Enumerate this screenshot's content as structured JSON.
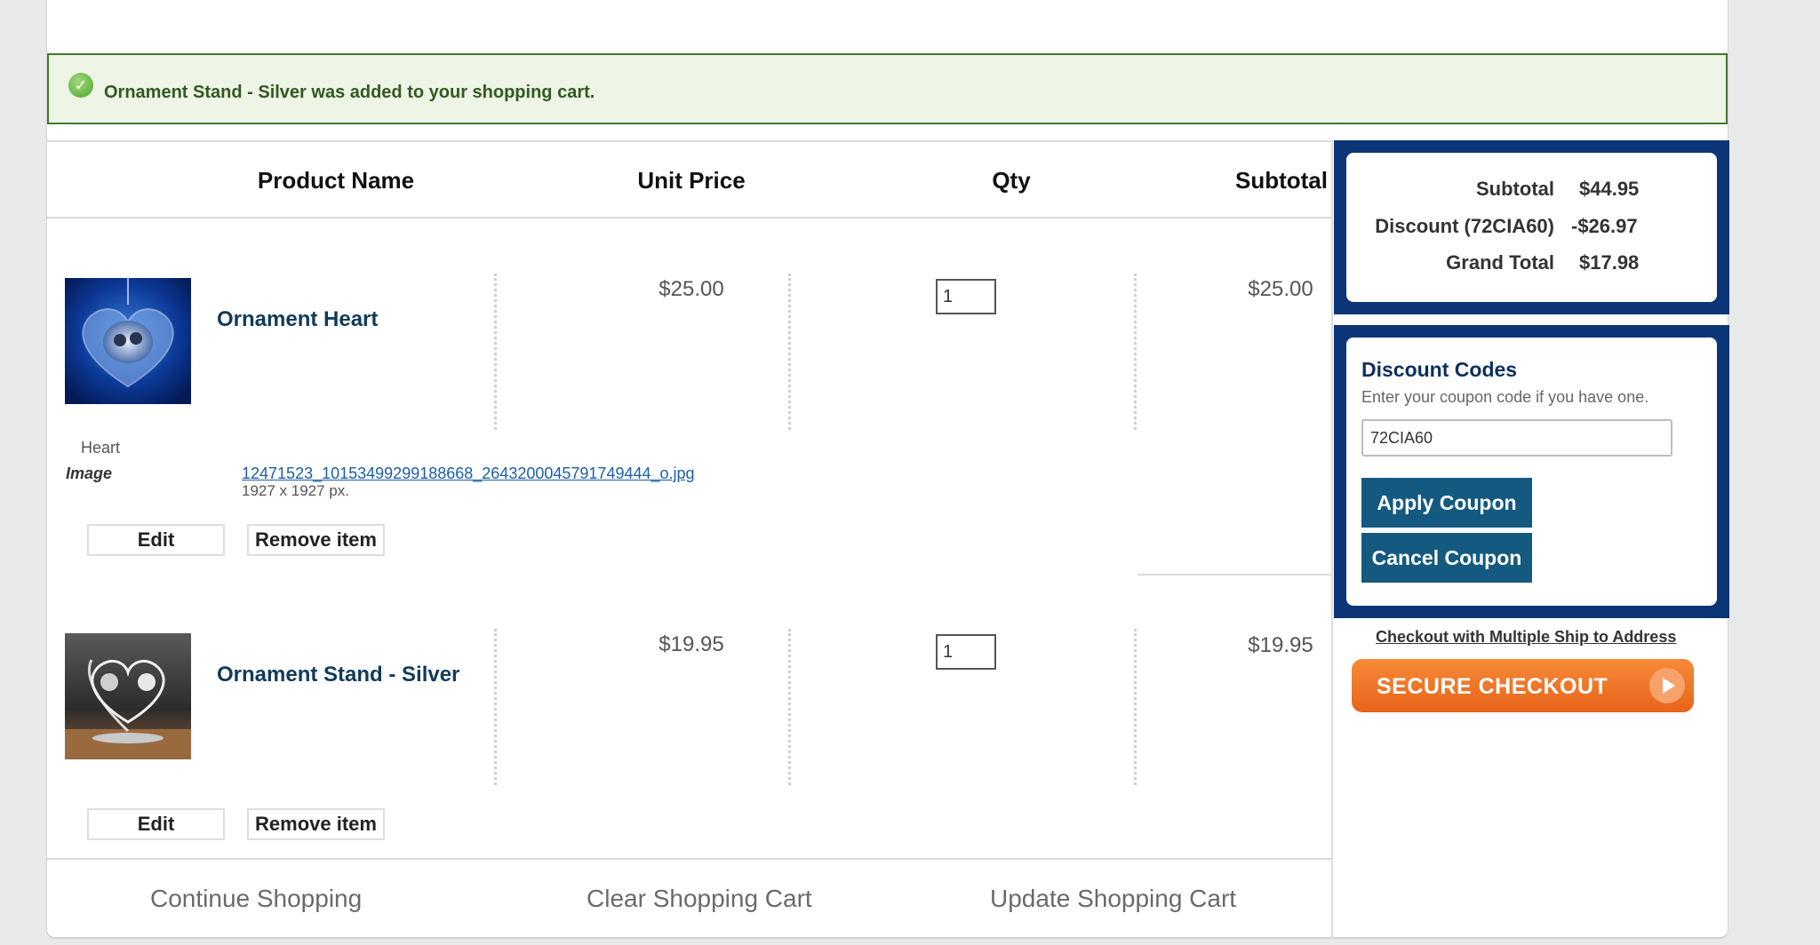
{
  "notice": {
    "message": "Ornament Stand - Silver was added to your shopping cart."
  },
  "table": {
    "headers": {
      "product": "Product Name",
      "unit_price": "Unit Price",
      "qty": "Qty",
      "subtotal": "Subtotal"
    }
  },
  "items": [
    {
      "name": "Ornament Heart",
      "unit_price": "$25.00",
      "qty": "1",
      "subtotal": "$25.00",
      "option_value": "Heart",
      "option_label": "Image",
      "file_name": "12471523_10153499299188668_2643200045791749444_o.jpg",
      "file_dims": "1927 x 1927 px.",
      "edit_label": "Edit",
      "remove_label": "Remove item"
    },
    {
      "name": "Ornament Stand - Silver",
      "unit_price": "$19.95",
      "qty": "1",
      "subtotal": "$19.95",
      "edit_label": "Edit",
      "remove_label": "Remove item"
    }
  ],
  "footer": {
    "continue": "Continue Shopping",
    "clear": "Clear Shopping Cart",
    "update": "Update Shopping Cart"
  },
  "totals": {
    "subtotal_label": "Subtotal",
    "subtotal": "$44.95",
    "discount_label": "Discount (72CIA60)",
    "discount": "-$26.97",
    "grand_label": "Grand Total",
    "grand": "$17.98"
  },
  "discount": {
    "title": "Discount Codes",
    "subtitle": "Enter your coupon code if you have one.",
    "code": "72CIA60",
    "apply_label": "Apply Coupon",
    "cancel_label": "Cancel Coupon"
  },
  "checkout": {
    "multi_ship": "Checkout with Multiple Ship to Address",
    "secure": "SECURE CHECKOUT"
  },
  "colors": {
    "navy": "#0b3577",
    "coupon_button": "#145a80",
    "checkout_orange": "#ef7528",
    "notice_green": "#3f7a2f"
  },
  "icons": [
    "check-circle-icon",
    "play-arrow-icon"
  ]
}
